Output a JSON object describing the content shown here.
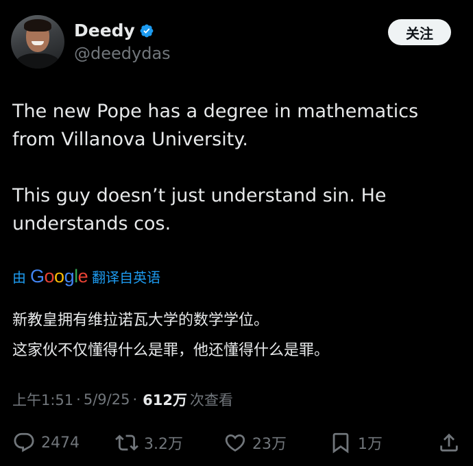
{
  "author": {
    "display_name": "Deedy",
    "handle": "@deedydas",
    "verified": true
  },
  "follow_label": "关注",
  "tweet": {
    "paragraph1": "The new Pope has a degree in mathematics from Villanova University.",
    "paragraph2": "This guy doesn’t just understand sin. He understands cos."
  },
  "translation": {
    "prefix": "由",
    "provider": "Google",
    "suffix": "翻译自英语",
    "line1": "新教皇拥有维拉诺瓦大学的数学学位。",
    "line2": "这家伙不仅懂得什么是罪，他还懂得什么是罪。"
  },
  "meta": {
    "time": "上午1:51",
    "date": "5/9/25",
    "views_count": "612万",
    "views_label": "次查看",
    "separator": "·"
  },
  "actions": {
    "replies": "2474",
    "retweets": "3.2万",
    "likes": "23万",
    "bookmarks": "1万"
  },
  "icons": {
    "verified": "verified-badge-icon",
    "reply": "speech-bubble-icon",
    "retweet": "retweet-arrows-icon",
    "like": "heart-icon",
    "bookmark": "bookmark-icon",
    "share": "share-upload-icon"
  },
  "colors": {
    "background": "#000000",
    "text": "#e7e9ea",
    "secondary": "#71767b",
    "accent": "#1d9bf0"
  }
}
